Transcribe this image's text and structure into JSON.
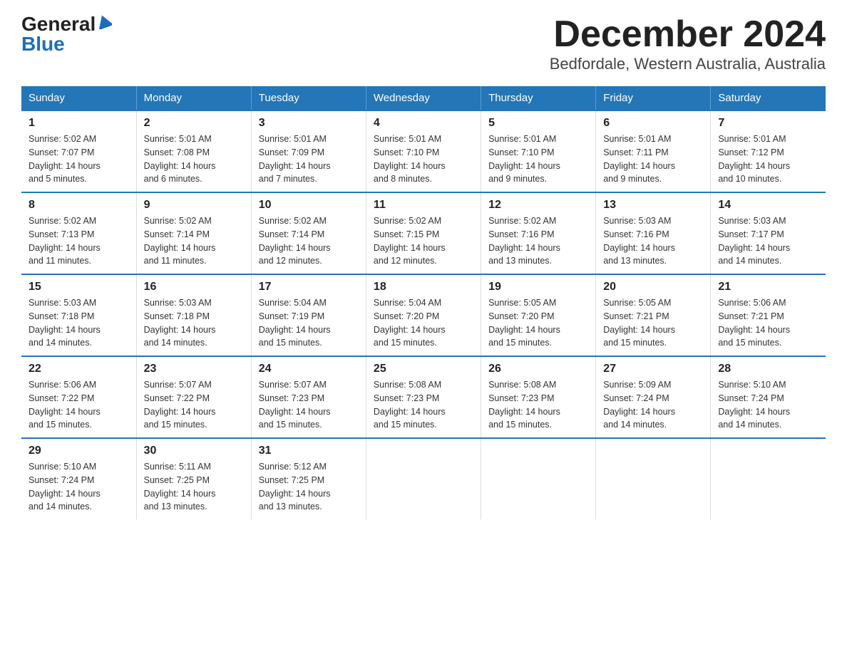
{
  "header": {
    "logo_general": "General",
    "logo_blue": "Blue",
    "title": "December 2024",
    "subtitle": "Bedfordale, Western Australia, Australia"
  },
  "days_of_week": [
    "Sunday",
    "Monday",
    "Tuesday",
    "Wednesday",
    "Thursday",
    "Friday",
    "Saturday"
  ],
  "weeks": [
    [
      {
        "day": 1,
        "sunrise": "5:02 AM",
        "sunset": "7:07 PM",
        "daylight": "14 hours and 5 minutes."
      },
      {
        "day": 2,
        "sunrise": "5:01 AM",
        "sunset": "7:08 PM",
        "daylight": "14 hours and 6 minutes."
      },
      {
        "day": 3,
        "sunrise": "5:01 AM",
        "sunset": "7:09 PM",
        "daylight": "14 hours and 7 minutes."
      },
      {
        "day": 4,
        "sunrise": "5:01 AM",
        "sunset": "7:10 PM",
        "daylight": "14 hours and 8 minutes."
      },
      {
        "day": 5,
        "sunrise": "5:01 AM",
        "sunset": "7:10 PM",
        "daylight": "14 hours and 9 minutes."
      },
      {
        "day": 6,
        "sunrise": "5:01 AM",
        "sunset": "7:11 PM",
        "daylight": "14 hours and 9 minutes."
      },
      {
        "day": 7,
        "sunrise": "5:01 AM",
        "sunset": "7:12 PM",
        "daylight": "14 hours and 10 minutes."
      }
    ],
    [
      {
        "day": 8,
        "sunrise": "5:02 AM",
        "sunset": "7:13 PM",
        "daylight": "14 hours and 11 minutes."
      },
      {
        "day": 9,
        "sunrise": "5:02 AM",
        "sunset": "7:14 PM",
        "daylight": "14 hours and 11 minutes."
      },
      {
        "day": 10,
        "sunrise": "5:02 AM",
        "sunset": "7:14 PM",
        "daylight": "14 hours and 12 minutes."
      },
      {
        "day": 11,
        "sunrise": "5:02 AM",
        "sunset": "7:15 PM",
        "daylight": "14 hours and 12 minutes."
      },
      {
        "day": 12,
        "sunrise": "5:02 AM",
        "sunset": "7:16 PM",
        "daylight": "14 hours and 13 minutes."
      },
      {
        "day": 13,
        "sunrise": "5:03 AM",
        "sunset": "7:16 PM",
        "daylight": "14 hours and 13 minutes."
      },
      {
        "day": 14,
        "sunrise": "5:03 AM",
        "sunset": "7:17 PM",
        "daylight": "14 hours and 14 minutes."
      }
    ],
    [
      {
        "day": 15,
        "sunrise": "5:03 AM",
        "sunset": "7:18 PM",
        "daylight": "14 hours and 14 minutes."
      },
      {
        "day": 16,
        "sunrise": "5:03 AM",
        "sunset": "7:18 PM",
        "daylight": "14 hours and 14 minutes."
      },
      {
        "day": 17,
        "sunrise": "5:04 AM",
        "sunset": "7:19 PM",
        "daylight": "14 hours and 15 minutes."
      },
      {
        "day": 18,
        "sunrise": "5:04 AM",
        "sunset": "7:20 PM",
        "daylight": "14 hours and 15 minutes."
      },
      {
        "day": 19,
        "sunrise": "5:05 AM",
        "sunset": "7:20 PM",
        "daylight": "14 hours and 15 minutes."
      },
      {
        "day": 20,
        "sunrise": "5:05 AM",
        "sunset": "7:21 PM",
        "daylight": "14 hours and 15 minutes."
      },
      {
        "day": 21,
        "sunrise": "5:06 AM",
        "sunset": "7:21 PM",
        "daylight": "14 hours and 15 minutes."
      }
    ],
    [
      {
        "day": 22,
        "sunrise": "5:06 AM",
        "sunset": "7:22 PM",
        "daylight": "14 hours and 15 minutes."
      },
      {
        "day": 23,
        "sunrise": "5:07 AM",
        "sunset": "7:22 PM",
        "daylight": "14 hours and 15 minutes."
      },
      {
        "day": 24,
        "sunrise": "5:07 AM",
        "sunset": "7:23 PM",
        "daylight": "14 hours and 15 minutes."
      },
      {
        "day": 25,
        "sunrise": "5:08 AM",
        "sunset": "7:23 PM",
        "daylight": "14 hours and 15 minutes."
      },
      {
        "day": 26,
        "sunrise": "5:08 AM",
        "sunset": "7:23 PM",
        "daylight": "14 hours and 15 minutes."
      },
      {
        "day": 27,
        "sunrise": "5:09 AM",
        "sunset": "7:24 PM",
        "daylight": "14 hours and 14 minutes."
      },
      {
        "day": 28,
        "sunrise": "5:10 AM",
        "sunset": "7:24 PM",
        "daylight": "14 hours and 14 minutes."
      }
    ],
    [
      {
        "day": 29,
        "sunrise": "5:10 AM",
        "sunset": "7:24 PM",
        "daylight": "14 hours and 14 minutes."
      },
      {
        "day": 30,
        "sunrise": "5:11 AM",
        "sunset": "7:25 PM",
        "daylight": "14 hours and 13 minutes."
      },
      {
        "day": 31,
        "sunrise": "5:12 AM",
        "sunset": "7:25 PM",
        "daylight": "14 hours and 13 minutes."
      },
      null,
      null,
      null,
      null
    ]
  ],
  "labels": {
    "sunrise": "Sunrise:",
    "sunset": "Sunset:",
    "daylight": "Daylight:"
  }
}
